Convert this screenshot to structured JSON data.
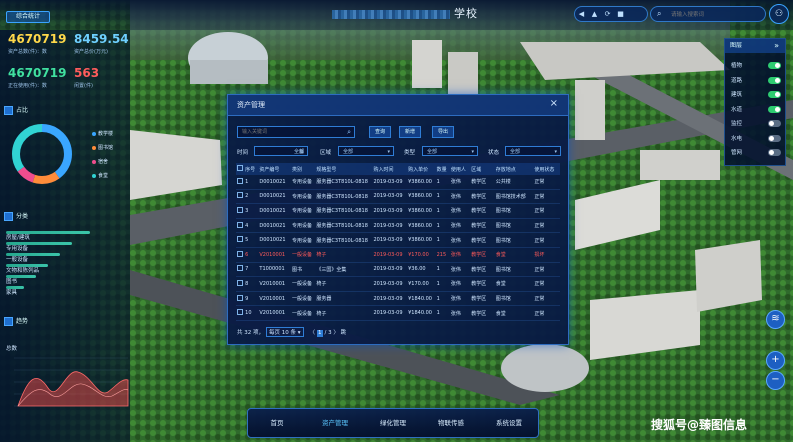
{
  "header": {
    "badge": "综合统计",
    "title": "学校",
    "tools": [
      "◀",
      "▲",
      "⟳",
      "■"
    ],
    "search_placeholder": "请输入搜索词",
    "user_icon": "user-icon"
  },
  "stats": [
    {
      "value": "4670719",
      "label": "资产总数(件)：数",
      "color": "#ffd84a"
    },
    {
      "value": "8459.54",
      "label": "资产总价(万元)",
      "color": "#6fd0ff"
    },
    {
      "value": "4670719",
      "label": "正在使用(件)：数",
      "color": "#40e0a0"
    },
    {
      "value": "563",
      "label": "闲置(件)",
      "color": "#ff5c5c"
    }
  ],
  "donut": {
    "section": "占比",
    "legend": [
      {
        "label": "教学楼",
        "color": "#3aa6ff",
        "pct": 0.4
      },
      {
        "label": "图书馆",
        "color": "#ff8c3a",
        "pct": 0.15
      },
      {
        "label": "宿舍",
        "color": "#f04d8e",
        "pct": 0.1
      },
      {
        "label": "食堂",
        "color": "#31d3d3",
        "pct": 0.35
      }
    ]
  },
  "category": {
    "section": "分类",
    "items": [
      {
        "label": "房屋/建筑",
        "level": 0.7
      },
      {
        "label": "专用设备",
        "level": 0.55
      },
      {
        "label": "一般设备",
        "level": 0.45
      },
      {
        "label": "文物和陈列品",
        "level": 0.35
      },
      {
        "label": "图书",
        "level": 0.25
      },
      {
        "label": "家具",
        "level": 0.15
      }
    ]
  },
  "trend": {
    "section": "趋势",
    "ylabel": "总数"
  },
  "layers": {
    "title": "图层",
    "collapse": "»",
    "items": [
      {
        "label": "植物",
        "on": true
      },
      {
        "label": "道路",
        "on": true
      },
      {
        "label": "建筑",
        "on": true
      },
      {
        "label": "水道",
        "on": true
      },
      {
        "label": "监控",
        "on": false
      },
      {
        "label": "水电",
        "on": false
      },
      {
        "label": "管网",
        "on": false
      }
    ]
  },
  "map_controls": {
    "layers_icon": "≋",
    "zoom_in": "+",
    "zoom_out": "−"
  },
  "modal": {
    "title": "资产管理",
    "close": "×",
    "search_placeholder": "输入关键词",
    "buttons": [
      "查询",
      "新增",
      "导出"
    ],
    "filters": [
      {
        "label": "时间",
        "value": "全部"
      },
      {
        "label": "区域",
        "value": "全部"
      },
      {
        "label": "类型",
        "value": "全部"
      },
      {
        "label": "状态",
        "value": "全部"
      }
    ],
    "columns": [
      "序号",
      "资产编号",
      "类别",
      "规格型号",
      "购入时间",
      "购入单价",
      "数量",
      "使用人",
      "区域",
      "存放地点",
      "使用状态"
    ],
    "rows": [
      {
        "no": "1",
        "code": "D0010021",
        "cat": "专用设备",
        "model": "服务器C3T810L-0818",
        "date": "2019-03-09",
        "price": "¥3860.00",
        "qty": "1",
        "user": "张伟",
        "area": "教学区",
        "place": "公共楼",
        "status": "正常",
        "warn": false
      },
      {
        "no": "2",
        "code": "D0010021",
        "cat": "专用设备",
        "model": "服务器C3T810L-0818",
        "date": "2019-03-09",
        "price": "¥3860.00",
        "qty": "1",
        "user": "张伟",
        "area": "教学区",
        "place": "图书馆技术部",
        "status": "正常",
        "warn": false
      },
      {
        "no": "3",
        "code": "D0010021",
        "cat": "专用设备",
        "model": "服务器C3T810L-0818",
        "date": "2019-03-09",
        "price": "¥3860.00",
        "qty": "1",
        "user": "张伟",
        "area": "教学区",
        "place": "图书馆",
        "status": "正常",
        "warn": false
      },
      {
        "no": "4",
        "code": "D0010021",
        "cat": "专用设备",
        "model": "服务器C3T810L-0818",
        "date": "2019-03-09",
        "price": "¥3860.00",
        "qty": "1",
        "user": "张伟",
        "area": "教学区",
        "place": "图书馆",
        "status": "正常",
        "warn": false
      },
      {
        "no": "5",
        "code": "D0010021",
        "cat": "专用设备",
        "model": "服务器C3T810L-0818",
        "date": "2019-03-09",
        "price": "¥3860.00",
        "qty": "1",
        "user": "张伟",
        "area": "教学区",
        "place": "图书馆",
        "status": "正常",
        "warn": false
      },
      {
        "no": "6",
        "code": "V2010001",
        "cat": "一般设备",
        "model": "椅子",
        "date": "2019-03-09",
        "price": "¥170.00",
        "qty": "215",
        "user": "张伟",
        "area": "教学区",
        "place": "食堂",
        "status": "损坏",
        "warn": true
      },
      {
        "no": "7",
        "code": "T1000001",
        "cat": "图书",
        "model": "《三国》全集",
        "date": "2019-03-09",
        "price": "¥36.00",
        "qty": "1",
        "user": "张伟",
        "area": "教学区",
        "place": "图书馆",
        "status": "正常",
        "warn": false
      },
      {
        "no": "8",
        "code": "V2010001",
        "cat": "一般设备",
        "model": "椅子",
        "date": "2019-03-09",
        "price": "¥170.00",
        "qty": "1",
        "user": "张伟",
        "area": "教学区",
        "place": "食堂",
        "status": "正常",
        "warn": false
      },
      {
        "no": "9",
        "code": "V2010001",
        "cat": "一般设备",
        "model": "服务器",
        "date": "2019-03-09",
        "price": "¥1840.00",
        "qty": "1",
        "user": "张伟",
        "area": "教学区",
        "place": "图书馆",
        "status": "正常",
        "warn": false
      },
      {
        "no": "10",
        "code": "V2010001",
        "cat": "一般设备",
        "model": "椅子",
        "date": "2019-03-09",
        "price": "¥1840.00",
        "qty": "1",
        "user": "张伟",
        "area": "教学区",
        "place": "食堂",
        "status": "正常",
        "warn": false
      }
    ],
    "pager": {
      "total": "共 32 项，",
      "page_size": "每页 10 条 ▾",
      "prev": "〈",
      "current": "1",
      "sep": "/ 3",
      "next": "〉",
      "jump": "跳"
    }
  },
  "bottom_nav": {
    "items": [
      {
        "label": "首页",
        "active": false
      },
      {
        "label": "资产管理",
        "active": true
      },
      {
        "label": "绿化管理",
        "active": false
      },
      {
        "label": "物联传感",
        "active": false
      },
      {
        "label": "系统设置",
        "active": false
      }
    ]
  },
  "watermark": "搜狐号@臻图信息"
}
